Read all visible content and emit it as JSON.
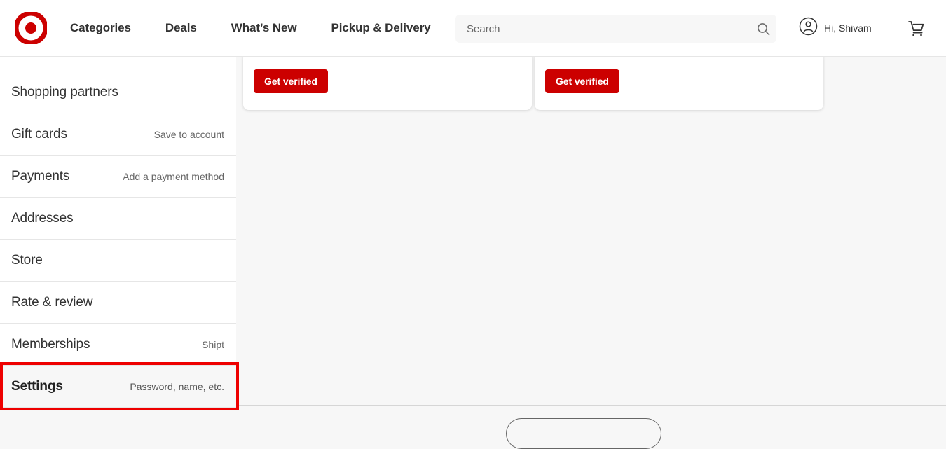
{
  "header": {
    "logo_name": "Target bullseye logo",
    "brand_color": "#cc0000",
    "nav": [
      {
        "label": "Categories"
      },
      {
        "label": "Deals"
      },
      {
        "label": "What’s New"
      },
      {
        "label": "Pickup & Delivery"
      }
    ],
    "search": {
      "placeholder": "Search",
      "value": ""
    },
    "account": {
      "greeting": "Hi, Shivam"
    },
    "cart": {
      "label": "Cart"
    }
  },
  "sidebar": {
    "items": [
      {
        "label": "",
        "meta": "",
        "selected": false,
        "partial": true
      },
      {
        "label": "Shopping partners",
        "meta": "",
        "selected": false
      },
      {
        "label": "Gift cards",
        "meta": "Save to account",
        "selected": false
      },
      {
        "label": "Payments",
        "meta": "Add a payment method",
        "selected": false
      },
      {
        "label": "Addresses",
        "meta": "",
        "selected": false
      },
      {
        "label": "Store",
        "meta": "",
        "selected": false
      },
      {
        "label": "Rate & review",
        "meta": "",
        "selected": false
      },
      {
        "label": "Memberships",
        "meta": "Shipt",
        "selected": false
      },
      {
        "label": "Settings",
        "meta": "Password, name, etc.",
        "selected": true
      }
    ],
    "highlight_color": "#ee0000"
  },
  "main": {
    "cards": [
      {
        "headline": "",
        "cta_label": "Get verified"
      },
      {
        "headline": "",
        "cta_label": "Get verified"
      }
    ],
    "cta_color": "#cc0000"
  }
}
